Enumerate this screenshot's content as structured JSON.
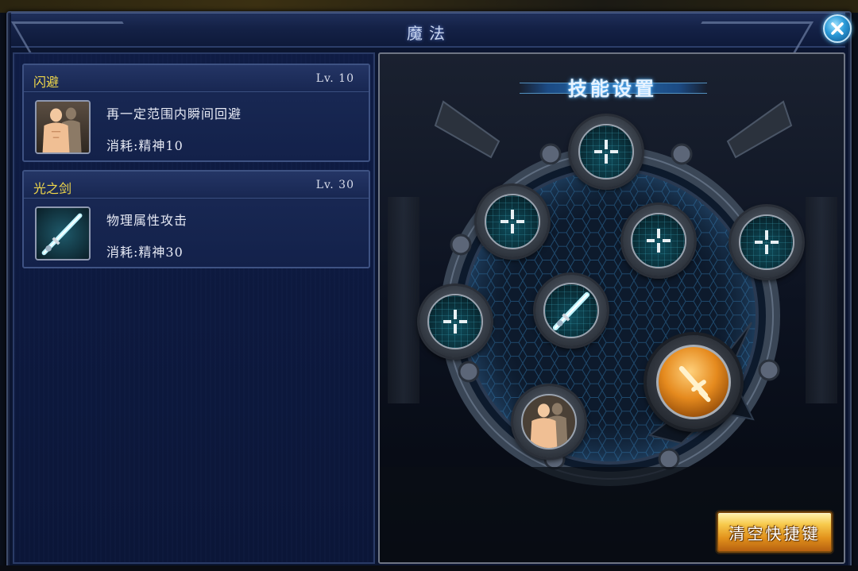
{
  "window": {
    "title": "魔法"
  },
  "skills": [
    {
      "name": "闪避",
      "level": "Lv. 10",
      "description": "再一定范围内瞬间回避",
      "cost": "消耗:精神10",
      "icon": "dodge-figure-icon"
    },
    {
      "name": "光之剑",
      "level": "Lv. 30",
      "description": "物理属性攻击",
      "cost": "消耗:精神30",
      "icon": "light-sword-icon"
    }
  ],
  "skill_settings": {
    "title": "技能设置",
    "clear_button": "清空快捷键",
    "slots": [
      {
        "id": "top",
        "content": "empty-slot-icon"
      },
      {
        "id": "upper-left",
        "content": "empty-slot-icon"
      },
      {
        "id": "middle",
        "content": "empty-slot-icon"
      },
      {
        "id": "upper-right",
        "content": "empty-slot-icon"
      },
      {
        "id": "left",
        "content": "empty-slot-icon"
      },
      {
        "id": "center",
        "content": "light-sword-icon"
      },
      {
        "id": "bottom",
        "content": "dodge-figure-icon"
      }
    ],
    "attack_button_icon": "sword-icon"
  },
  "colors": {
    "skill_name": "#f1d84a",
    "accent_blue": "#2b86d8",
    "attack_orange": "#e58a1e",
    "panel_bg": "#0f1c44"
  }
}
